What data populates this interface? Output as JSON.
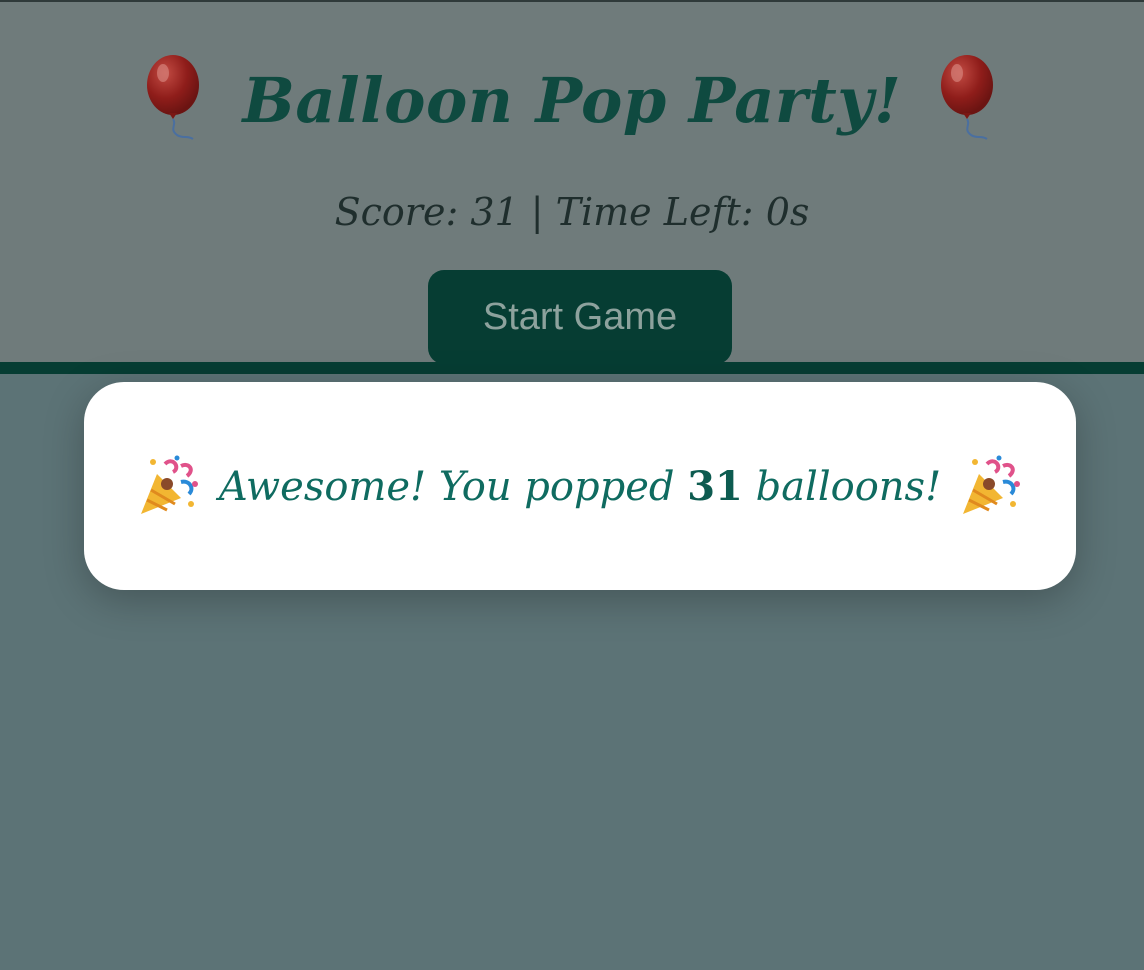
{
  "header": {
    "title": "Balloon Pop Party!",
    "left_icon": "balloon-icon",
    "right_icon": "balloon-icon",
    "status": "Score: 31 | Time Left: 0s",
    "start_button_label": "Start Game"
  },
  "result": {
    "icon": "party-popper-icon",
    "prefix": "Awesome! You popped",
    "count": "31",
    "suffix": "balloons!"
  },
  "colors": {
    "header_overlay": "#6f7b7b",
    "page_overlay": "#5c7376",
    "accent": "#063d33",
    "title": "#0f4a40",
    "result_text": "#0f6b60",
    "card": "#ffffff"
  }
}
